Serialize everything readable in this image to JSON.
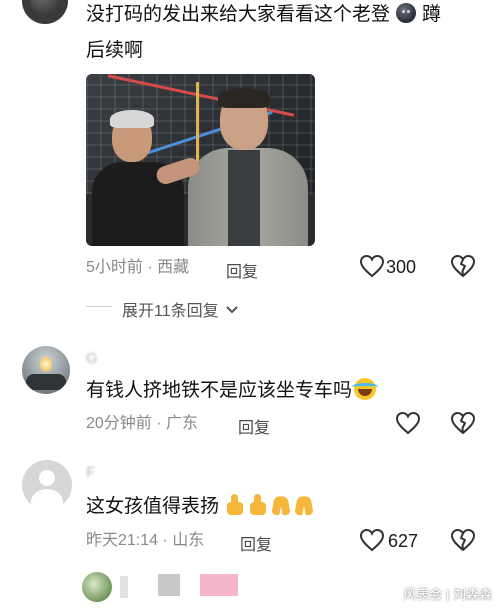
{
  "comments": [
    {
      "text_line1": "没打码的发出来给大家看看这个老登",
      "text_tail": "蹲",
      "text_line2": "后续啊",
      "time": "5小时前",
      "region": "西藏",
      "reply_label": "回复",
      "like_count": "300",
      "expand_label": "展开11条回复"
    },
    {
      "username": "G",
      "text": "有钱人挤地铁不是应该坐专车吗",
      "time": "20分钟前",
      "region": "广东",
      "reply_label": "回复"
    },
    {
      "username": "F",
      "text": "这女孩值得表扬",
      "time": "昨天21:14",
      "region": "山东",
      "reply_label": "回复",
      "like_count": "627"
    }
  ],
  "separator": "·",
  "icons": {
    "like": "heart-outline-icon",
    "dislike": "broken-heart-icon",
    "expand": "chevron-down-icon"
  },
  "watermark": "风表会 | 刘森森",
  "colors": {
    "meta_gray": "#8a8a8a",
    "text": "#111111",
    "redact_gray": "#c8c8c8",
    "redact_pink": "#f4b6c8"
  }
}
